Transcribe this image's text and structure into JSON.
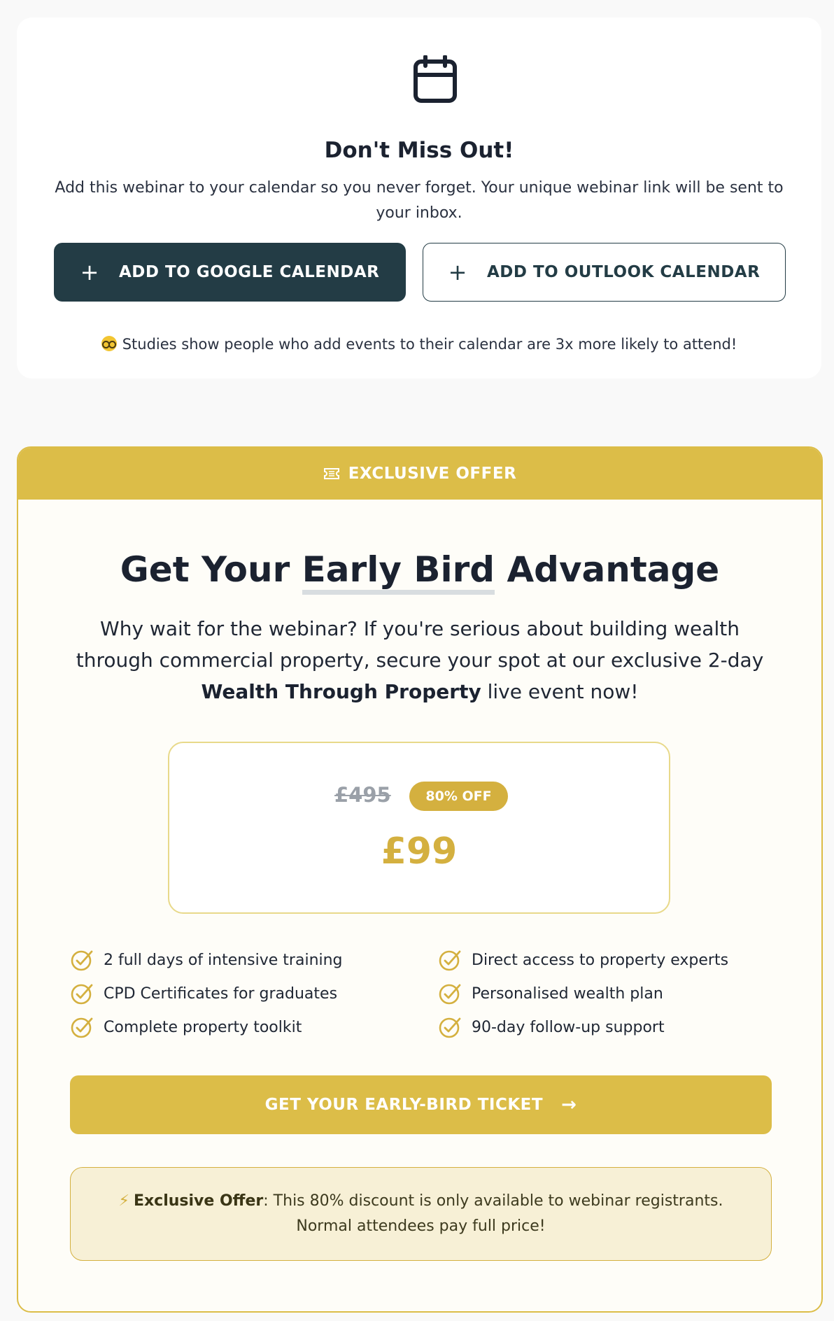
{
  "calendar": {
    "title": "Don't Miss Out!",
    "description": "Add this webinar to your calendar so you never forget. Your unique webinar link will be sent to your inbox.",
    "google_button": "ADD TO GOOGLE CALENDAR",
    "outlook_button": "ADD TO OUTLOOK CALENDAR",
    "plus_glyph": "+",
    "note": "Studies show people who add events to their calendar are 3x more likely to attend!",
    "icons": {
      "calendar": "calendar-icon",
      "plus": "plus-icon",
      "note": "nerd-face-emoji"
    }
  },
  "offer": {
    "banner": "EXCLUSIVE OFFER",
    "title_pre": "Get Your ",
    "title_highlight": "Early Bird",
    "title_post": " Advantage",
    "desc_pre": "Why wait for the webinar? If you're serious about building wealth through commercial property, secure your spot at our exclusive 2-day ",
    "desc_bold": "Wealth Through Property",
    "desc_post": " live event now!",
    "old_price": "£495",
    "discount_badge": "80% OFF",
    "new_price": "£99",
    "features": [
      "2 full days of intensive training",
      "CPD Certificates for graduates",
      "Complete property toolkit",
      "Direct access to property experts",
      "Personalised wealth plan",
      "90-day follow-up support"
    ],
    "cta_label": "GET YOUR EARLY-BIRD TICKET",
    "cta_arrow": "→",
    "notice_bolt": "⚡",
    "notice_bold": "Exclusive Offer",
    "notice_text": ": This 80% discount is only available to webinar registrants. Normal attendees pay full price!",
    "icons": {
      "banner": "ticket-icon",
      "feature": "check-circle-icon",
      "cta": "arrow-right-icon",
      "notice": "lightning-icon"
    }
  },
  "colors": {
    "dark_teal": "#233c45",
    "gold": "#dcbd48",
    "gold_text": "#d4b03f",
    "notice_bg": "#f7f0d6"
  }
}
